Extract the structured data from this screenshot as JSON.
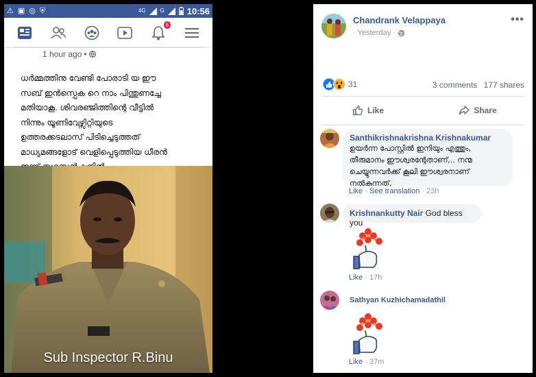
{
  "phone": {
    "status_bar": {
      "net_1": "4G",
      "net_2": "G",
      "time": "10:56"
    },
    "post": {
      "time": "1 hour ago",
      "privacy_separator": "•",
      "text_lines": [
        "ധർമ്മത്തിനു വേണ്ടി പോരാടി യ ഈ",
        "സബ് ഇൻസ്പെക റെ നാം പിന്തുണച്ചേ",
        "മതിയാകൂ. ശിവരഞ്ജിത്തിന്റെ വീട്ടിൽ",
        "നിന്നും യൂണിവേഴ്സിറ്റിയുടെ",
        "ഉത്തരക്കടലാസ് പിടിച്ചെടുത്തത്",
        "മാധ്യമങ്ങളോട് വെളിപ്പെടുത്തിയ ധീരൻ",
        "ഇന്ന് സസ്പെൻഷനിൽ -"
      ],
      "photo_caption": "Sub Inspector R.Binu"
    },
    "nav": {
      "notification_count": "6"
    }
  },
  "facebook_post": {
    "poster_name": "Chandrank Velappaya",
    "time": "Yesterday",
    "separator": "·",
    "reaction_count": "31",
    "comments_count": "3 comments",
    "shares_count": "177 shares",
    "like_label": "Like",
    "share_label": "Share",
    "comments": [
      {
        "name": "Santhikrishnakrishna Krishnakumar",
        "lines": [
          "ഉയർന്ന പോസ്റ്റിൽ ഇനിയും എത്തും,",
          "തീരുമാനം ഈശ്വരന്റേതാണ്,.. നന്മ",
          "ചെയ്യുന്നവർക്ക് കൂലി ഈശ്വരനാണ്",
          "നൽകുന്നത്,"
        ],
        "like_label": "Like",
        "translation_label": "See translation",
        "time": "23h"
      },
      {
        "name": "Krishnankutty Nair",
        "text": "God bless you",
        "like_label": "Like",
        "time": "17h"
      },
      {
        "name": "Sathyan Kuzhichamadathil",
        "like_label": "Like",
        "time": "37m"
      }
    ]
  },
  "colors": {
    "fb_blue": "#3b5998",
    "link_blue": "#385898",
    "notification_red": "#e41e3f",
    "meta_gray": "#90949c",
    "bubble_gray": "#f2f3f5"
  }
}
